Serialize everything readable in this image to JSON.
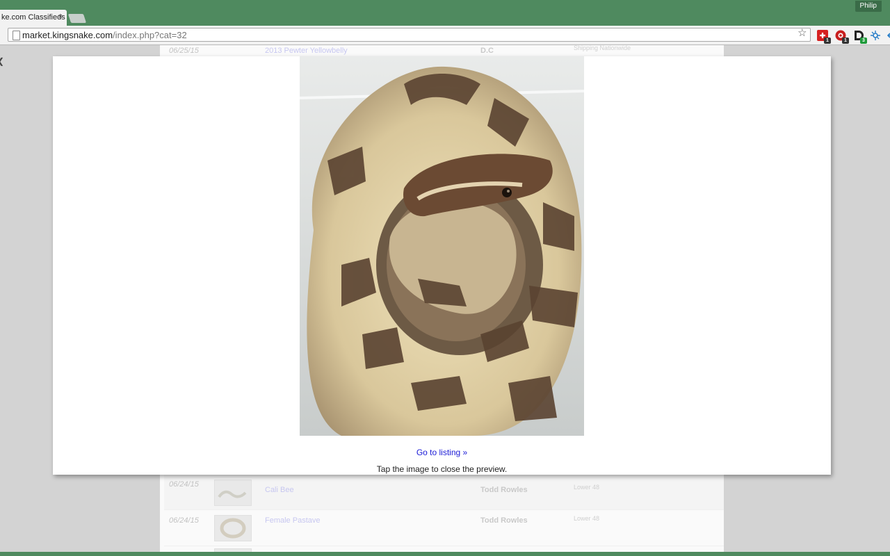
{
  "browser": {
    "tab_title": "ke.com Classifieds",
    "tab_close": "×",
    "profile_name": "Philip",
    "url_host": "market.kingsnake.com",
    "url_path": "/index.php?cat=32",
    "star_icon": "☆",
    "extensions": [
      {
        "icon": "red-puzzle-icon",
        "badge": "1"
      },
      {
        "icon": "red-circle-icon",
        "badge": "1"
      },
      {
        "icon": "d-letter-icon",
        "badge": "3"
      },
      {
        "icon": "network-icon",
        "badge": ""
      }
    ]
  },
  "listing": {
    "rows": [
      {
        "date": "06/25/15",
        "title": "2013 Pewter Yellowbelly",
        "seller": "D.C",
        "shipping": "Shipping Nationwide"
      },
      {
        "date": "06/24/15",
        "title": "Cali Bee",
        "seller": "Todd Rowles",
        "shipping": "Lower 48"
      },
      {
        "date": "06/24/15",
        "title": "Female Pastave",
        "seller": "Todd Rowles",
        "shipping": "Lower 48"
      }
    ]
  },
  "preview": {
    "image_subject": "coiled ball python",
    "goto_link": "Go to listing »",
    "close_hint": "Tap the image to close the preview."
  },
  "colors": {
    "chrome_green": "#4f8a5f",
    "link_blue": "#1a1ad6"
  }
}
